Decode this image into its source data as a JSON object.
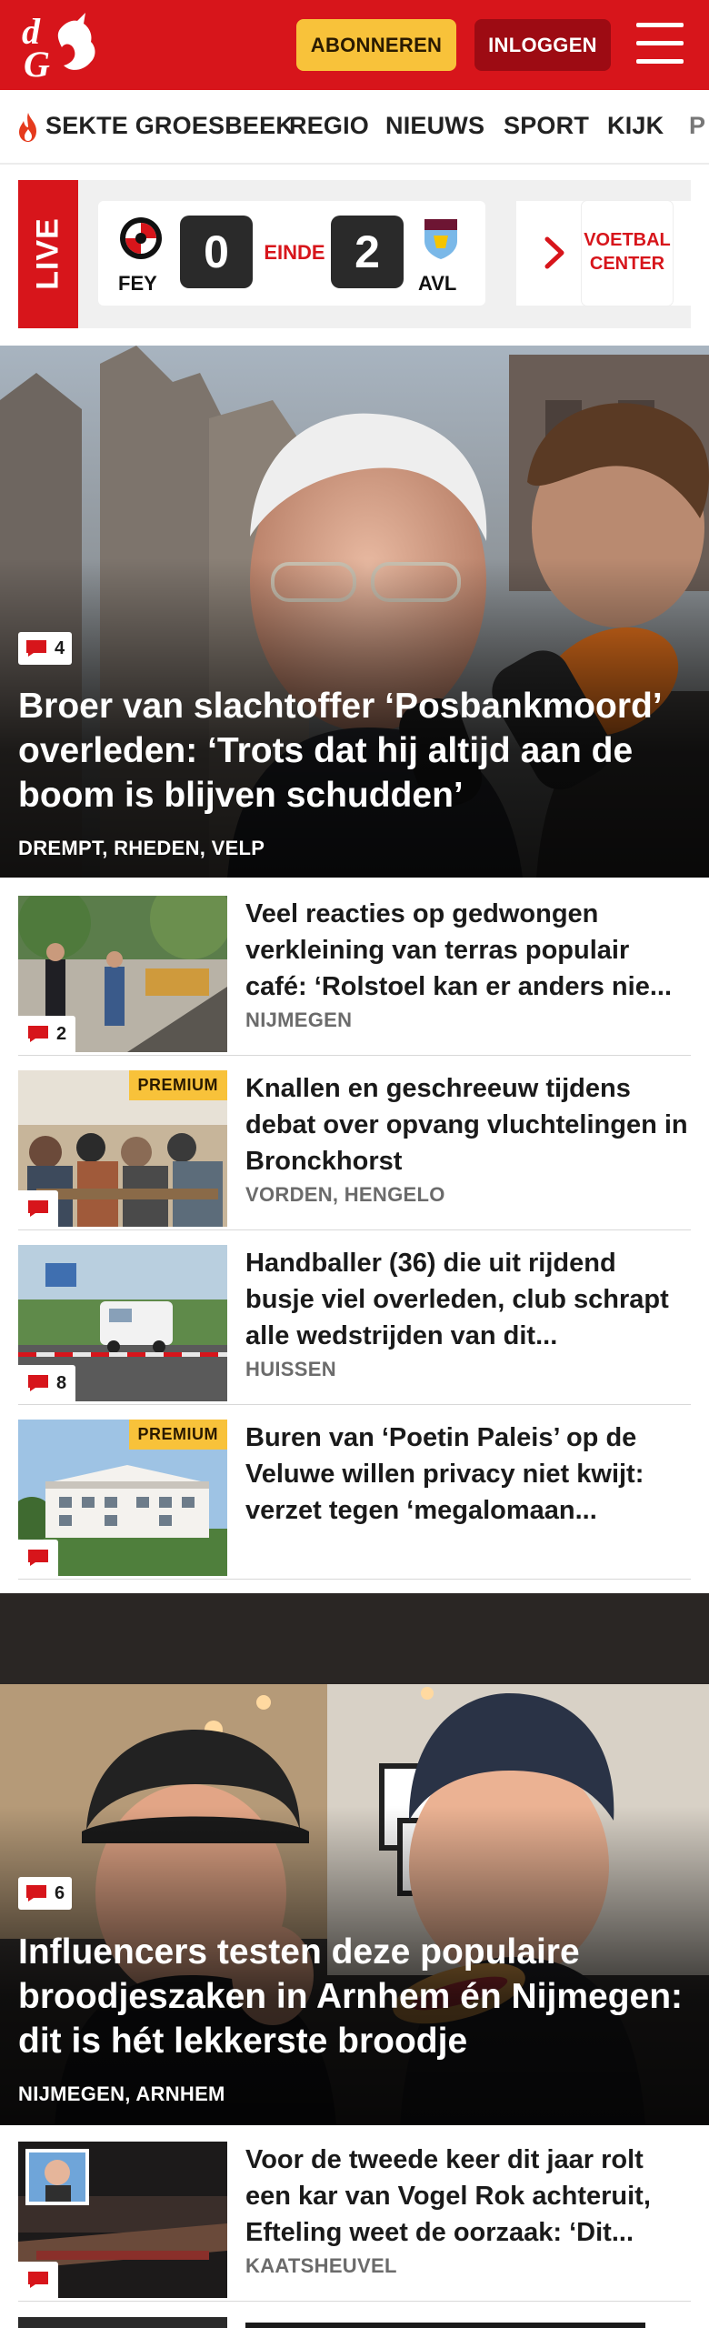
{
  "brand": {
    "accent": "#d7151b",
    "premium": "#f8c23a",
    "logo_text": "dG"
  },
  "header": {
    "subscribe_label": "ABONNEREN",
    "login_label": "INLOGGEN"
  },
  "nav": {
    "items": [
      "SEKTE GROESBEEK",
      "REGIO",
      "NIEUWS",
      "SPORT",
      "KIJK",
      "P"
    ]
  },
  "live": {
    "label": "LIVE",
    "home": {
      "code": "FEY",
      "score": "0"
    },
    "away": {
      "code": "AVL",
      "score": "2"
    },
    "status": "EINDE",
    "center_label_1": "VOETBAL",
    "center_label_2": "CENTER"
  },
  "hero1": {
    "comments": "4",
    "title": "Broer van slachtoffer ‘Posbankmoord’ overleden: ‘Trots dat hij altijd aan de boom is blijven schudden’",
    "location": "DREMPT, RHEDEN, VELP"
  },
  "articles": [
    {
      "title": "Veel reacties op gedwongen verkleining van terras populair café: ‘Rolstoel kan er anders nie...",
      "location": "NIJMEGEN",
      "comments": "2",
      "premium": ""
    },
    {
      "title": "Knallen en geschreeuw tijdens debat over opvang vluchtelingen in Bronckhorst",
      "location": "VORDEN, HENGELO",
      "comments": "",
      "premium": "PREMIUM"
    },
    {
      "title": "Handballer (36) die uit rijdend busje viel overleden, club schrapt alle wedstrijden van dit...",
      "location": "HUISSEN",
      "comments": "8",
      "premium": ""
    },
    {
      "title": "Buren van ‘Poetin Paleis’ op de Veluwe willen privacy niet kwijt: verzet tegen ‘megalomaan...",
      "location": "",
      "comments": "",
      "premium": "PREMIUM"
    }
  ],
  "hero2": {
    "comments": "6",
    "title": "Influencers testen deze populaire broodjeszaken in Arnhem én Nijmegen: dit is hét lekkerste broodje",
    "location": "NIJMEGEN, ARNHEM"
  },
  "article_last": {
    "title": "Voor de tweede keer dit jaar rolt een kar van Vogel Rok achteruit, Efteling weet de oorzaak: ‘Dit...",
    "location": "KAATSHEUVEL",
    "comments": ""
  },
  "icons": {
    "logo": "dg-logo-icon",
    "menu": "hamburger-menu-icon",
    "flame": "flame-icon",
    "comment": "comment-bubble-icon",
    "next": "chevron-right-icon"
  }
}
